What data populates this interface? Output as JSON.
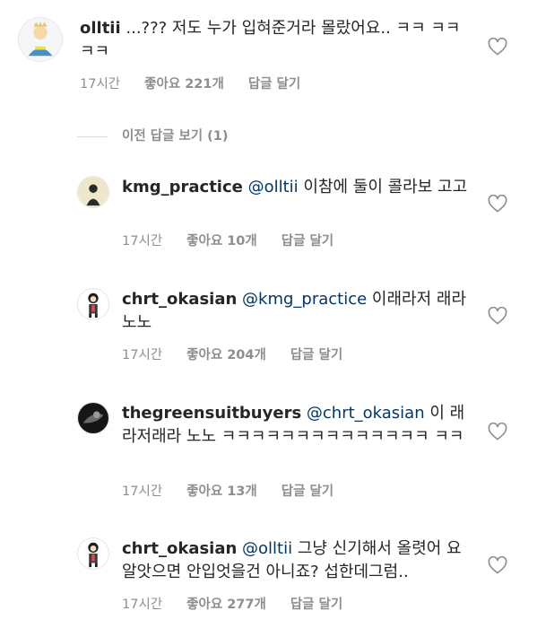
{
  "comments": [
    {
      "username": "olltii",
      "mention": "",
      "text": " ...??? 저도 누가 입혀준거라 몰랐어요.. ㅋㅋ ㅋㅋㅋㅋ",
      "time": "17시간",
      "likes": "좋아요 221개",
      "reply": "답글 달기"
    },
    {
      "username": "kmg_practice",
      "mention": "@olltii",
      "text": " 이참에 둘이 콜라보 고고",
      "time": "17시간",
      "likes": "좋아요 10개",
      "reply": "답글 달기"
    },
    {
      "username": "chrt_okasian",
      "mention": "@kmg_practice",
      "text": " 이래라저 래라 노노",
      "time": "17시간",
      "likes": "좋아요 204개",
      "reply": "답글 달기"
    },
    {
      "username": "thegreensuitbuyers",
      "mention": "@chrt_okasian",
      "text": " 이 래라저래라 노노 ㅋㅋㅋㅋㅋㅋㅋㅋㅋㅋㅋㅋㅋㅋ ㅋㅋ",
      "time": "17시간",
      "likes": "좋아요 13개",
      "reply": "답글 달기"
    },
    {
      "username": "chrt_okasian",
      "mention": "@olltii",
      "text": " 그냥 신기해서 올렷어 요 알앗으면 안입엇을건 아니죠? 섭한데그럼..",
      "time": "17시간",
      "likes": "좋아요 277개",
      "reply": "답글 달기"
    }
  ],
  "view_previous": "이전 답글 보기 (1)"
}
